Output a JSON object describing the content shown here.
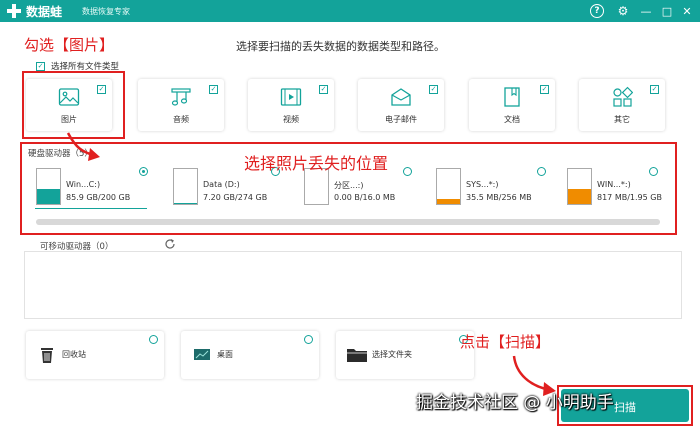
{
  "app": {
    "logo_text": "数据蛙",
    "subtitle": "数据恢复专家",
    "help_glyph": "?",
    "settings_glyph": "⚙",
    "minimize_glyph": "—",
    "maximize_glyph": "□",
    "close_glyph": "✕"
  },
  "instruction": "选择要扫描的丢失数据的数据类型和路径。",
  "select_all": {
    "label": "选择所有文件类型",
    "checked": true
  },
  "file_types": [
    {
      "label": "图片",
      "icon": "image-icon",
      "checked": true
    },
    {
      "label": "音频",
      "icon": "music-icon",
      "checked": true
    },
    {
      "label": "视频",
      "icon": "video-icon",
      "checked": true
    },
    {
      "label": "电子邮件",
      "icon": "mail-icon",
      "checked": true
    },
    {
      "label": "文档",
      "icon": "document-icon",
      "checked": true
    },
    {
      "label": "其它",
      "icon": "other-icon",
      "checked": true
    }
  ],
  "drives": {
    "header": "硬盘驱动器（5）",
    "items": [
      {
        "name": "Win...C:)",
        "size": "85.9 GB/200 GB",
        "used_fraction": 0.43,
        "fill_color": "#13a39a",
        "selected": true
      },
      {
        "name": "Data (D:)",
        "size": "7.20 GB/274 GB",
        "used_fraction": 0.03,
        "fill_color": "#13a39a",
        "selected": false
      },
      {
        "name": "分区...:)",
        "size": "0.00  B/16.0 MB",
        "used_fraction": 0.0,
        "fill_color": "#13a39a",
        "selected": false
      },
      {
        "name": "SYS...*:)",
        "size": "35.5 MB/256 MB",
        "used_fraction": 0.14,
        "fill_color": "#f08c00",
        "selected": false
      },
      {
        "name": "WIN...*:)",
        "size": "817 MB/1.95 GB",
        "used_fraction": 0.42,
        "fill_color": "#f08c00",
        "selected": false
      }
    ]
  },
  "removable": {
    "header": "可移动驱动器（0）"
  },
  "locations": [
    {
      "label": "回收站",
      "icon": "recycle-bin-icon"
    },
    {
      "label": "桌面",
      "icon": "desktop-icon"
    },
    {
      "label": "选择文件夹",
      "icon": "folder-icon"
    }
  ],
  "scan_button": {
    "label": "扫描"
  },
  "annotations": {
    "choose_picture": "勾选【图片】",
    "choose_location": "选择照片丢失的位置",
    "click_scan": "点击【扫描】"
  },
  "watermark": "掘金技术社区 @ 小明助手",
  "colors": {
    "accent": "#13a39a",
    "warning": "#f08c00",
    "annotation": "#e02020"
  }
}
